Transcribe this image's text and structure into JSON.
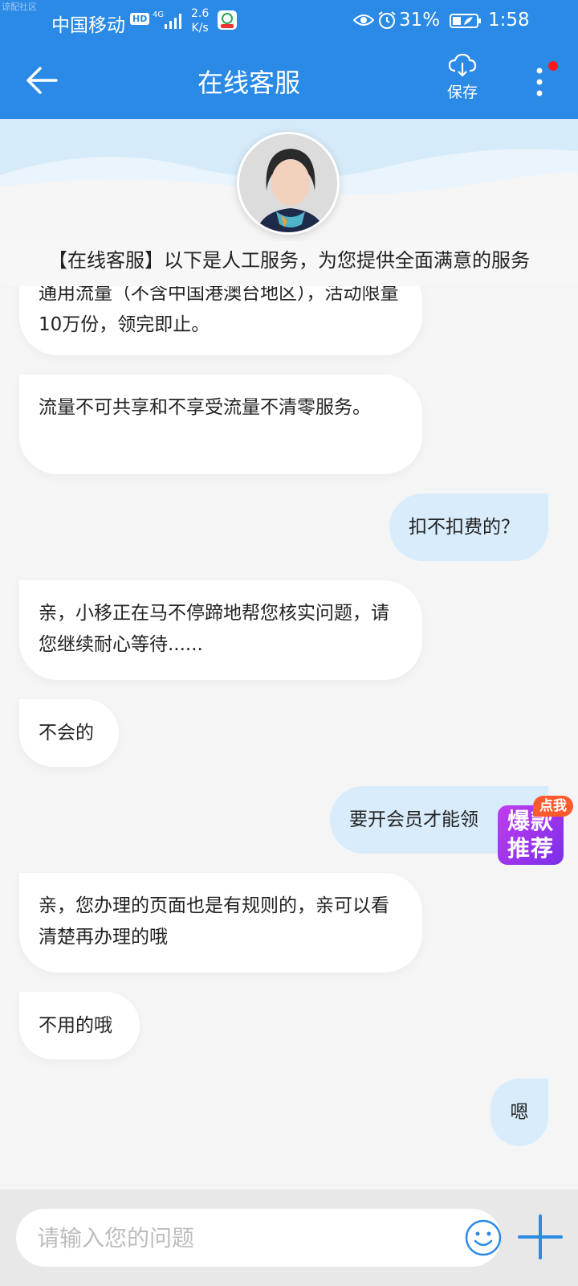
{
  "status_bar": {
    "watermark": "谅配社区",
    "carrier": "中国移动",
    "hd": "HD",
    "network": "4G",
    "speed_value": "2.6",
    "speed_unit": "K/s",
    "battery": "31%",
    "time": "1:58"
  },
  "header": {
    "title": "在线客服",
    "save_label": "保存"
  },
  "notice": "【在线客服】以下是人工服务，为您提供全面满意的服务",
  "messages": [
    {
      "side": "left",
      "text": "通用流量（不含中国港澳台地区），活动限量10万份，领完即止。"
    },
    {
      "side": "left",
      "text": "流量不可共享和不享受流量不清零服务。"
    },
    {
      "side": "right",
      "text": "扣不扣费的？"
    },
    {
      "side": "left",
      "text": "亲，小移正在马不停蹄地帮您核实问题，请您继续耐心等待......"
    },
    {
      "side": "left",
      "text": "不会的"
    },
    {
      "side": "right",
      "text": "要开会员才能领"
    },
    {
      "side": "left",
      "text": "亲，您办理的页面也是有规则的，亲可以看清楚再办理的哦"
    },
    {
      "side": "left",
      "text": "不用的哦"
    },
    {
      "side": "right",
      "text": "嗯"
    }
  ],
  "promo": {
    "tag": "点我",
    "line1": "爆款",
    "line2": "推荐"
  },
  "input": {
    "placeholder": "请输入您的问题",
    "value": ""
  },
  "colors": {
    "brand": "#2a8ae6",
    "bubble_left": "#ffffff",
    "bubble_right": "#d8ecfb"
  }
}
